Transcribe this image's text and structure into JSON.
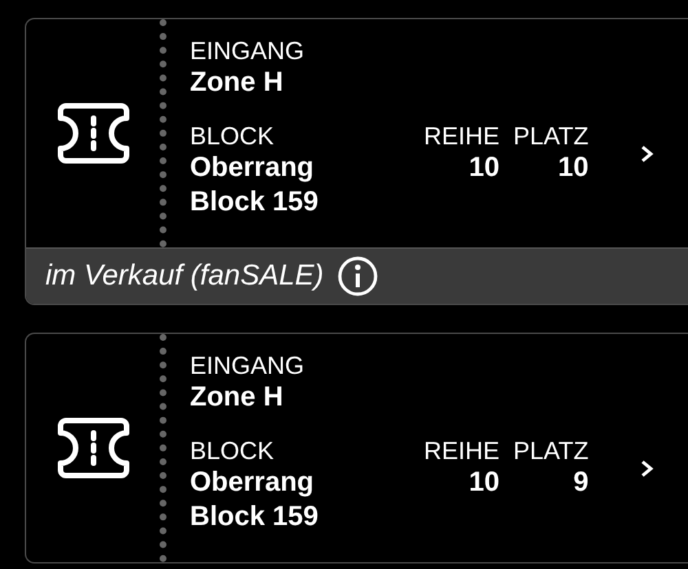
{
  "tickets": [
    {
      "entrance_label": "EINGANG",
      "entrance": "Zone H",
      "block_label": "BLOCK",
      "block": "Oberrang",
      "block_number": "Block 159",
      "row_label": "REIHE",
      "row": "10",
      "seat_label": "PLATZ",
      "seat": "10",
      "status": "im Verkauf (fanSALE)"
    },
    {
      "entrance_label": "EINGANG",
      "entrance": "Zone H",
      "block_label": "BLOCK",
      "block": "Oberrang",
      "block_number": "Block 159",
      "row_label": "REIHE",
      "row": "10",
      "seat_label": "PLATZ",
      "seat": "9"
    }
  ]
}
